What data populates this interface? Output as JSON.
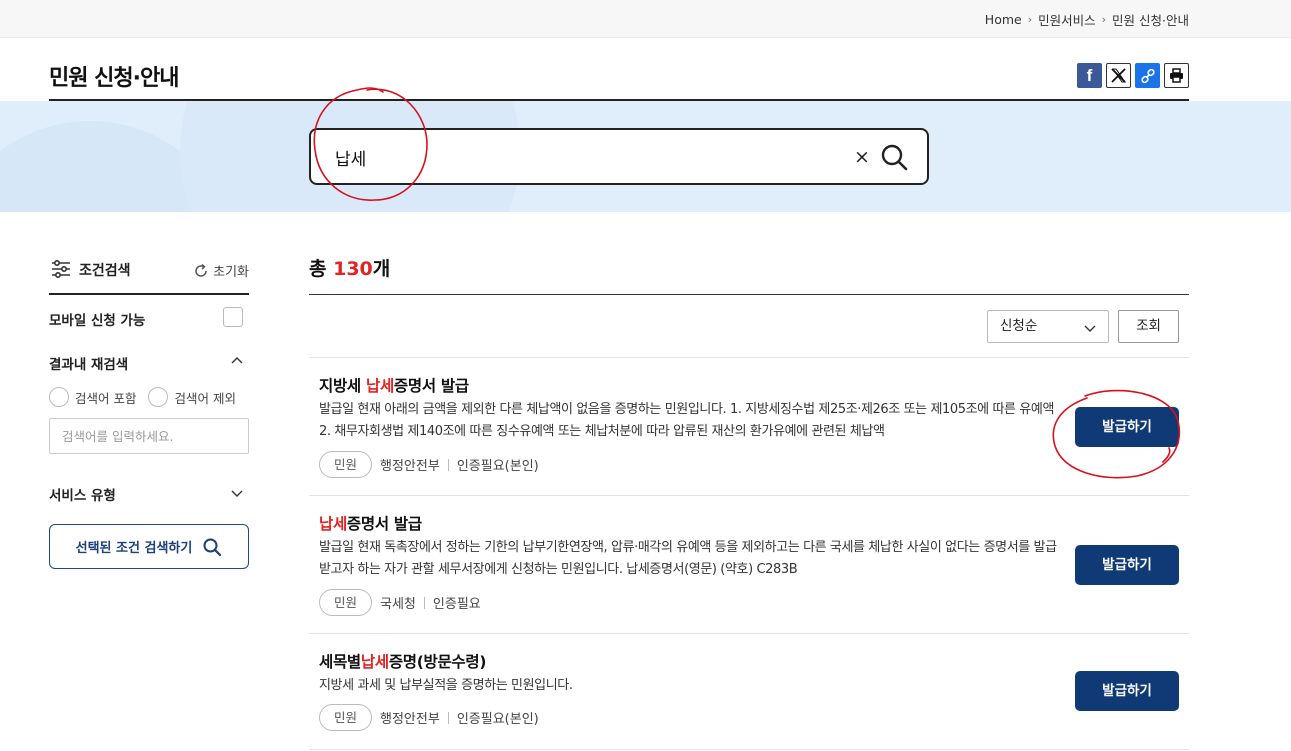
{
  "breadcrumb": {
    "home": "Home",
    "level1": "민원서비스",
    "level2": "민원 신청·안내"
  },
  "page_title": "민원 신청·안내",
  "share": {
    "facebook_glyph": "f"
  },
  "search": {
    "value": "납세",
    "clear_glyph": "×"
  },
  "sidebar": {
    "heading": "조건검색",
    "reset_label": "초기화",
    "mobile_label": "모바일 신청 가능",
    "refine_label": "결과내 재검색",
    "include_label": "검색어 포함",
    "exclude_label": "검색어 제외",
    "refine_placeholder": "검색어를 입력하세요.",
    "service_type_label": "서비스 유형",
    "cond_search_button": "선택된 조건 검색하기"
  },
  "results": {
    "total_prefix": "총 ",
    "total_count": "130",
    "total_suffix": "개",
    "sort_value": "신청순",
    "view_button": "조회",
    "items": [
      {
        "title_pre": "지방세 ",
        "title_hl": "납세",
        "title_post": "증명서 발급",
        "desc": "발급일 현재 아래의 금액을 제외한 다른 체납액이 없음을 증명하는 민원입니다. 1. 지방세징수법 제25조·제26조 또는 제105조에 따른 유예액 2. 채무자회생법 제140조에 따른 징수유예액 또는 체납처분에 따라 압류된 재산의 환가유예에 관련된 체납액",
        "tag": "민원",
        "agency": "행정안전부",
        "auth": "인증필요(본인)",
        "button": "발급하기"
      },
      {
        "title_pre": "",
        "title_hl": "납세",
        "title_post": "증명서 발급",
        "desc": "발급일 현재 독촉장에서 정하는 기한의 납부기한연장액, 압류·매각의 유예액 등을 제외하고는 다른 국세를 체납한 사실이 없다는 증명서를 발급받고자 하는 자가 관할 세무서장에게 신청하는 민원입니다. 납세증명서(영문) (약호) C283B",
        "tag": "민원",
        "agency": "국세청",
        "auth": "인증필요",
        "button": "발급하기"
      },
      {
        "title_pre": "세목별",
        "title_hl": "납세",
        "title_post": "증명(방문수령)",
        "desc": "지방세 과세 및 납부실적을 증명하는 민원입니다.",
        "tag": "민원",
        "agency": "행정안전부",
        "auth": "인증필요(본인)",
        "button": "발급하기"
      }
    ]
  },
  "colors": {
    "accent": "#0f3a76",
    "highlight": "#e02424",
    "annotation": "#d9101c"
  }
}
